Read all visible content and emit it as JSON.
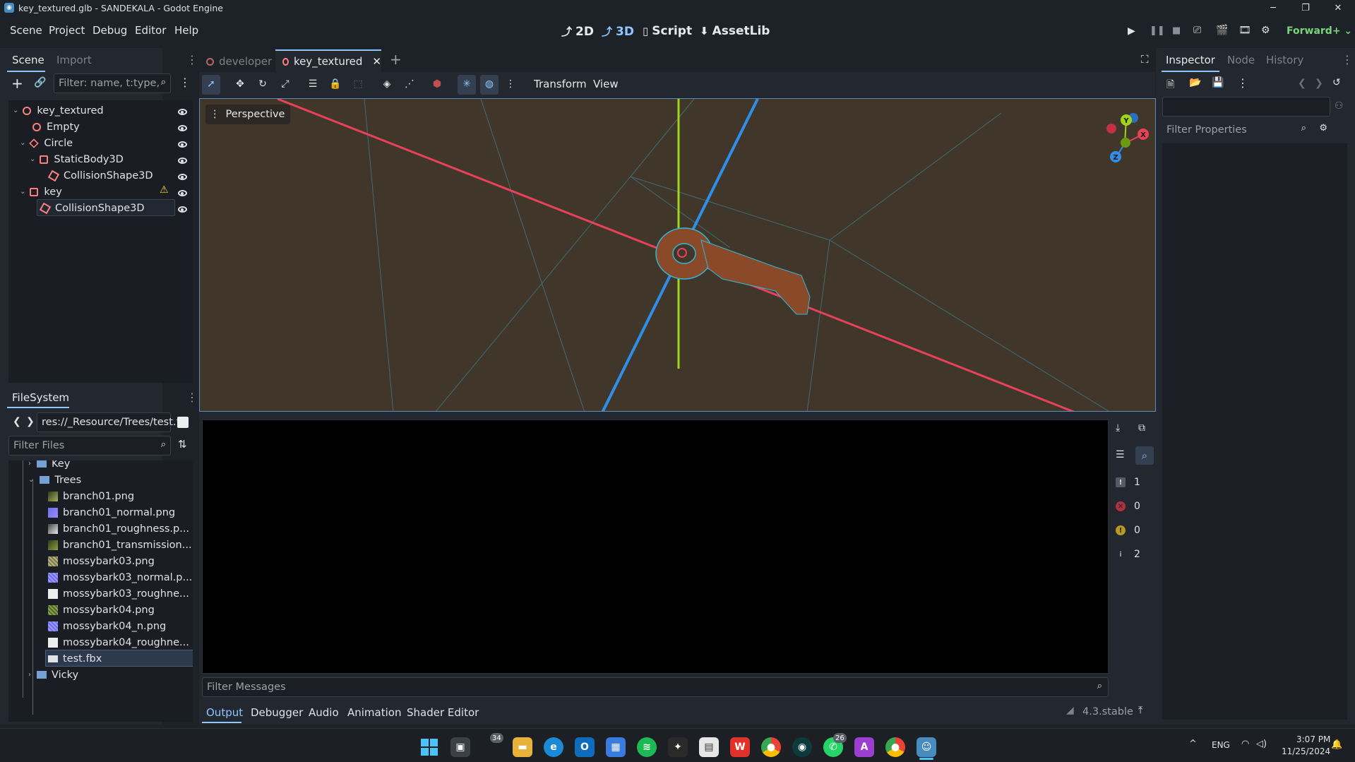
{
  "window": {
    "title": "key_textured.glb - SANDEKALA - Godot Engine",
    "min_label": "─",
    "max_label": "❐",
    "close_label": "✕"
  },
  "menu": [
    "Scene",
    "Project",
    "Debug",
    "Editor",
    "Help"
  ],
  "workspaces": [
    {
      "icon": "⤴",
      "label": "2D"
    },
    {
      "icon": "⤴",
      "label": "3D"
    },
    {
      "icon": "▯",
      "label": "Script"
    },
    {
      "icon": "⬇",
      "label": "AssetLib"
    }
  ],
  "renderer": "Forward+",
  "scene_dock": {
    "tabs": [
      "Scene",
      "Import"
    ],
    "filter_placeholder": "Filter: name, t:type,",
    "tree": [
      {
        "label": "key_textured",
        "icon": "node3d-icon",
        "depth": 0,
        "expanded": true
      },
      {
        "label": "Empty",
        "icon": "node3d-icon",
        "depth": 1
      },
      {
        "label": "Circle",
        "icon": "mesh-icon",
        "depth": 1,
        "expanded": true
      },
      {
        "label": "StaticBody3D",
        "icon": "staticbody-icon",
        "depth": 2,
        "expanded": true
      },
      {
        "label": "CollisionShape3D",
        "icon": "collision-icon",
        "depth": 3
      },
      {
        "label": "key",
        "icon": "staticbody-icon",
        "depth": 1,
        "expanded": true,
        "warning": true
      },
      {
        "label": "CollisionShape3D",
        "icon": "collision-icon",
        "depth": 2,
        "selected": true
      }
    ]
  },
  "filesystem": {
    "tab": "FileSystem",
    "path": "res://_Resource/Trees/test.f",
    "filter_placeholder": "Filter Files",
    "items": [
      {
        "label": "Key",
        "type": "folder"
      },
      {
        "label": "Trees",
        "type": "folder"
      },
      {
        "label": "branch01.png",
        "type": "leaf"
      },
      {
        "label": "branch01_normal.png",
        "type": "normal"
      },
      {
        "label": "branch01_roughness.p...",
        "type": "leaf-white"
      },
      {
        "label": "branch01_transmission...",
        "type": "leaf"
      },
      {
        "label": "mossybark03.png",
        "type": "bark"
      },
      {
        "label": "mossybark03_normal.p...",
        "type": "normal"
      },
      {
        "label": "mossybark03_roughne...",
        "type": "white"
      },
      {
        "label": "mossybark04.png",
        "type": "bark-green"
      },
      {
        "label": "mossybark04_n.png",
        "type": "normal"
      },
      {
        "label": "mossybark04_roughne...",
        "type": "white"
      },
      {
        "label": "test.fbx",
        "type": "scene"
      },
      {
        "label": "Vicky",
        "type": "folder"
      }
    ]
  },
  "editor_tabs": [
    {
      "label": "developer"
    },
    {
      "label": "key_textured",
      "active": true
    }
  ],
  "viewport": {
    "toolbar_menus": [
      "Transform",
      "View"
    ],
    "perspective_label": "Perspective",
    "gizmo_labels": {
      "x": "X",
      "y": "Y",
      "z": "Z"
    }
  },
  "output": {
    "filter_placeholder": "Filter Messages",
    "counters": [
      {
        "kind": "messages",
        "value": "1"
      },
      {
        "kind": "errors",
        "value": "0"
      },
      {
        "kind": "warnings",
        "value": "0"
      },
      {
        "kind": "info",
        "value": "2"
      }
    ],
    "tabs": [
      "Output",
      "Debugger",
      "Audio",
      "Animation",
      "Shader Editor"
    ],
    "version": "4.3.stable"
  },
  "inspector": {
    "tabs": [
      "Inspector",
      "Node",
      "History"
    ],
    "filter_placeholder": "Filter Properties"
  },
  "taskbar": {
    "badges": {
      "teams": "34",
      "whatsapp": "26"
    },
    "lang": "ENG",
    "time": "3:07 PM",
    "date": "11/25/2024"
  },
  "colors": {
    "accent": "#8ec5ff",
    "viewport_bg": "#41362a",
    "x_axis": "#e8415a",
    "y_axis": "#a0d61a",
    "z_axis": "#2f8fe8",
    "key_color": "#8a4a2a"
  }
}
